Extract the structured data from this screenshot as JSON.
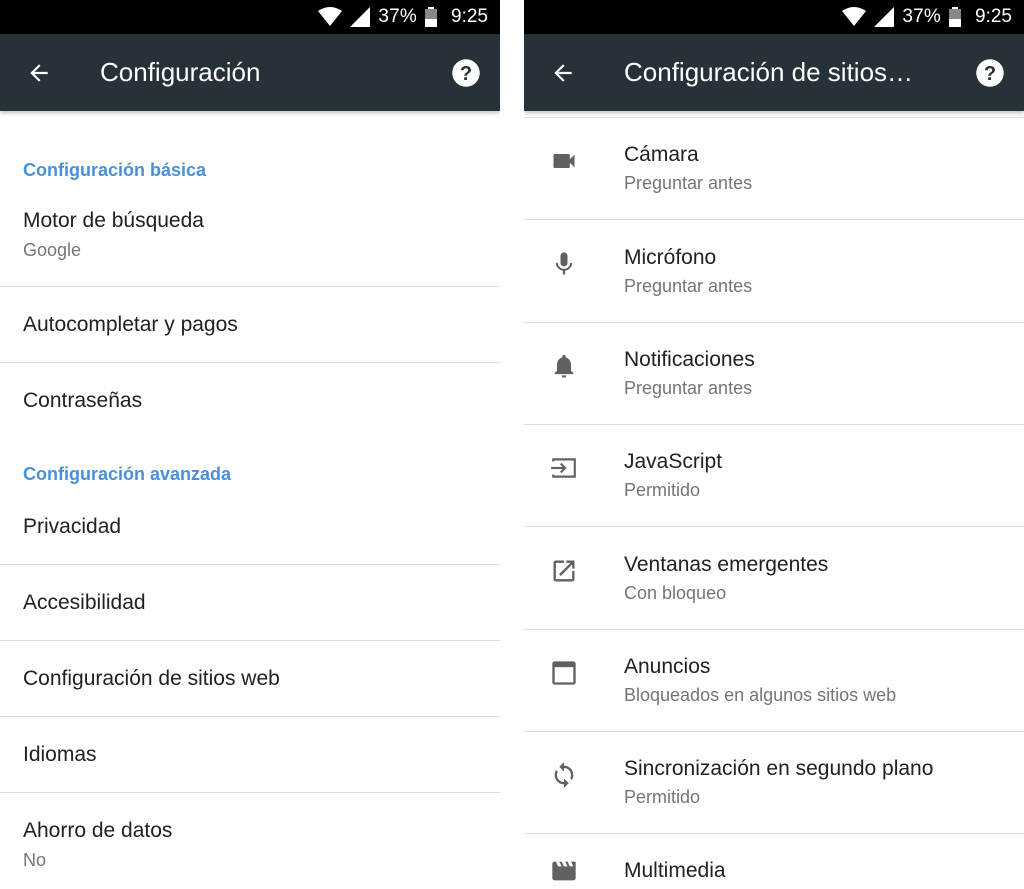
{
  "status_bar": {
    "battery": "37%",
    "time": "9:25"
  },
  "left": {
    "title": "Configuración",
    "sections": {
      "basic": "Configuración básica",
      "advanced": "Configuración avanzada"
    },
    "items": [
      {
        "label": "Motor de búsqueda",
        "sublabel": "Google"
      },
      {
        "label": "Autocompletar y pagos"
      },
      {
        "label": "Contraseñas"
      },
      {
        "label": "Privacidad"
      },
      {
        "label": "Accesibilidad"
      },
      {
        "label": "Configuración de sitios web"
      },
      {
        "label": "Idiomas"
      },
      {
        "label": "Ahorro de datos",
        "sublabel": "No"
      }
    ]
  },
  "right": {
    "title": "Configuración de sitios…",
    "items": [
      {
        "label": "Cámara",
        "sublabel": "Preguntar antes",
        "icon": "camera-icon"
      },
      {
        "label": "Micrófono",
        "sublabel": "Preguntar antes",
        "icon": "microphone-icon"
      },
      {
        "label": "Notificaciones",
        "sublabel": "Preguntar antes",
        "icon": "bell-icon"
      },
      {
        "label": "JavaScript",
        "sublabel": "Permitido",
        "icon": "javascript-icon"
      },
      {
        "label": "Ventanas emergentes",
        "sublabel": "Con bloqueo",
        "icon": "popup-icon"
      },
      {
        "label": "Anuncios",
        "sublabel": "Bloqueados en algunos sitios web",
        "icon": "ads-icon"
      },
      {
        "label": "Sincronización en segundo plano",
        "sublabel": "Permitido",
        "icon": "sync-icon"
      },
      {
        "label": "Multimedia",
        "icon": "media-icon"
      }
    ]
  },
  "colors": {
    "app_bar": "#263238",
    "status_bar": "#000000",
    "section_header": "#4a90d9",
    "primary_text": "#212121",
    "secondary_text": "#757575",
    "icon": "#616161"
  }
}
